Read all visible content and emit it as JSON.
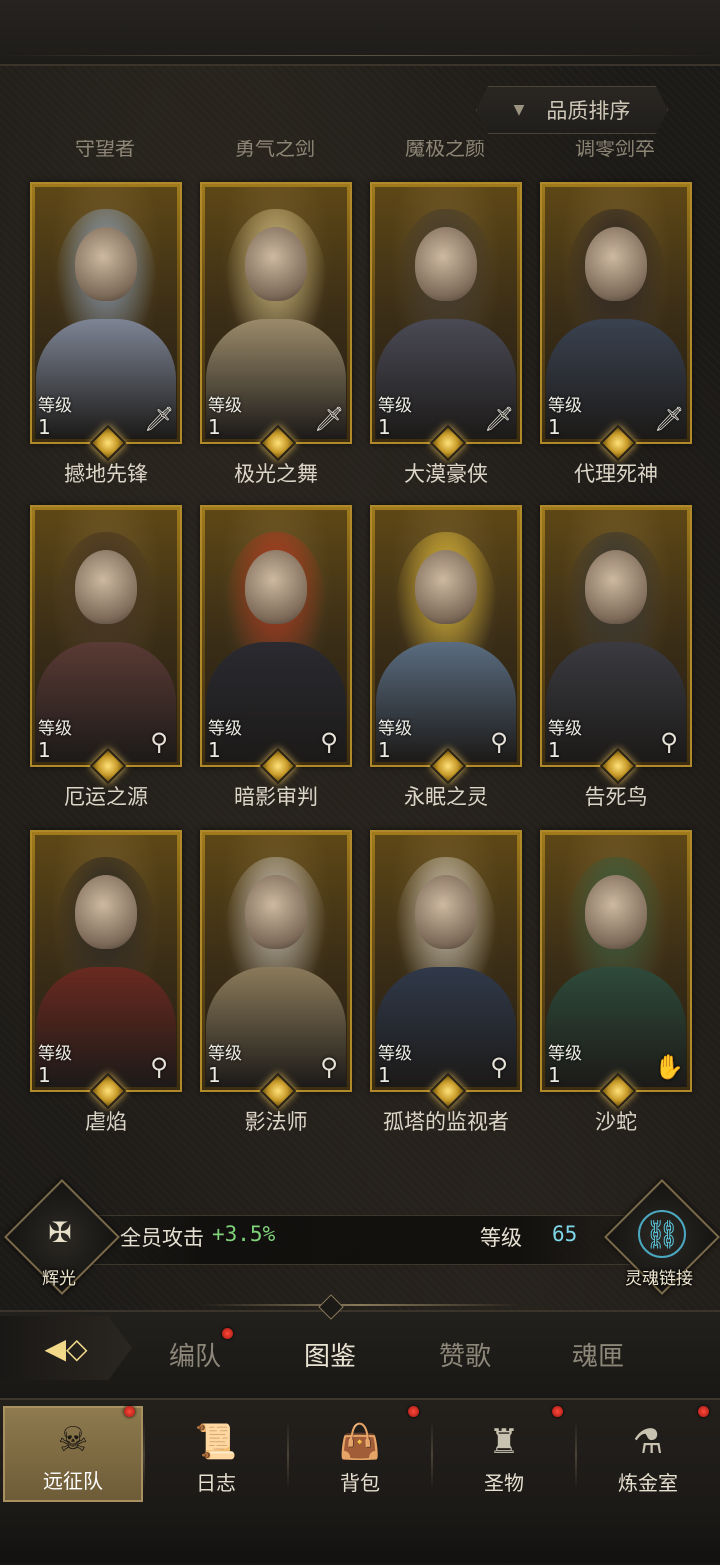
{
  "sort_button": {
    "label": "品质排序",
    "arrow": "▼"
  },
  "cut_names": [
    "守望者",
    "勇气之剑",
    "魔极之颜",
    "调零剑卒"
  ],
  "heroes": [
    {
      "name": "撼地先锋",
      "level_label": "等级",
      "level": "1",
      "role_icon": "sword-icon",
      "glyph": "🗡"
    },
    {
      "name": "极光之舞",
      "level_label": "等级",
      "level": "1",
      "role_icon": "sword-icon",
      "glyph": "🗡"
    },
    {
      "name": "大漠豪侠",
      "level_label": "等级",
      "level": "1",
      "role_icon": "sword-icon",
      "glyph": "🗡"
    },
    {
      "name": "代理死神",
      "level_label": "等级",
      "level": "1",
      "role_icon": "sword-icon",
      "glyph": "🗡"
    },
    {
      "name": "厄运之源",
      "level_label": "等级",
      "level": "1",
      "role_icon": "staff-icon",
      "glyph": "⚲"
    },
    {
      "name": "暗影审判",
      "level_label": "等级",
      "level": "1",
      "role_icon": "staff-icon",
      "glyph": "⚲"
    },
    {
      "name": "永眠之灵",
      "level_label": "等级",
      "level": "1",
      "role_icon": "staff-icon",
      "glyph": "⚲"
    },
    {
      "name": "告死鸟",
      "level_label": "等级",
      "level": "1",
      "role_icon": "staff-icon",
      "glyph": "⚲"
    },
    {
      "name": "虐焰",
      "level_label": "等级",
      "level": "1",
      "role_icon": "staff-icon",
      "glyph": "⚲"
    },
    {
      "name": "影法师",
      "level_label": "等级",
      "level": "1",
      "role_icon": "staff-icon",
      "glyph": "⚲"
    },
    {
      "name": "孤塔的监视者",
      "level_label": "等级",
      "level": "1",
      "role_icon": "staff-icon",
      "glyph": "⚲"
    },
    {
      "name": "沙蛇",
      "level_label": "等级",
      "level": "1",
      "role_icon": "hand-icon",
      "glyph": "✋"
    }
  ],
  "stats": {
    "left_emblem_label": "辉光",
    "left_stat_label": "全员攻击",
    "left_stat_value": "+3.5%",
    "right_stat_label": "等级",
    "right_stat_value": "65",
    "right_emblem_label": "灵魂链接"
  },
  "tabs": [
    {
      "label": "编队",
      "dot": true
    },
    {
      "label": "图鉴",
      "dot": false
    },
    {
      "label": "赞歌",
      "dot": false
    },
    {
      "label": "魂匣",
      "dot": false
    }
  ],
  "nav": [
    {
      "label": "远征队",
      "icon": "helmet-icon",
      "glyph": "☠",
      "dot": true
    },
    {
      "label": "日志",
      "icon": "scroll-icon",
      "glyph": "📜",
      "dot": false
    },
    {
      "label": "背包",
      "icon": "bag-icon",
      "glyph": "🎒",
      "dot": true
    },
    {
      "label": "圣物",
      "icon": "chalice-icon",
      "glyph": "🏆",
      "dot": true
    },
    {
      "label": "炼金室",
      "icon": "alchemy-icon",
      "glyph": "⚗",
      "dot": true
    }
  ],
  "colors": {
    "card_gold": "#b08a2a",
    "stat_green": "#7fd27a",
    "stat_cyan": "#7fd6e8",
    "notify_red": "#e02a1e"
  }
}
